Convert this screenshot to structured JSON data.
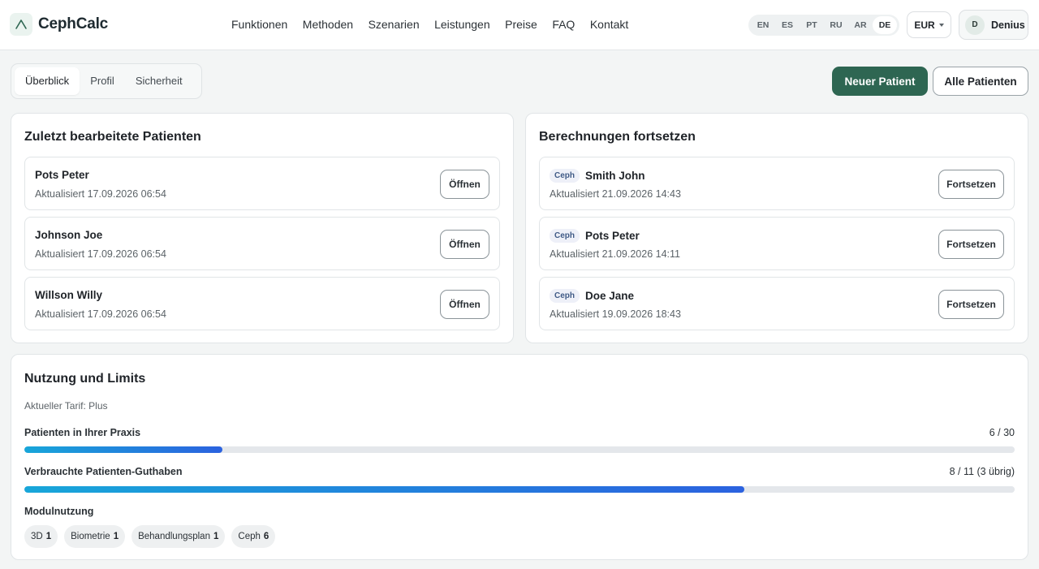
{
  "app": {
    "name": "CephCalc"
  },
  "nav": [
    "Funktionen",
    "Methoden",
    "Szenarien",
    "Leistungen",
    "Preise",
    "FAQ",
    "Kontakt"
  ],
  "languages": {
    "items": [
      "EN",
      "ES",
      "PT",
      "RU",
      "AR",
      "DE"
    ],
    "active": "DE"
  },
  "currency": {
    "value": "EUR"
  },
  "user": {
    "initial": "D",
    "name": "Denius"
  },
  "tabs": {
    "items": [
      "Überblick",
      "Profil",
      "Sicherheit"
    ],
    "active": "Überblick"
  },
  "actions": {
    "new_patient": "Neuer Patient",
    "all_patients": "Alle Patienten"
  },
  "recent_patients": {
    "title": "Zuletzt bearbeitete Patienten",
    "open_label": "Öffnen",
    "items": [
      {
        "name": "Pots Peter",
        "updated": "Aktualisiert 17.09.2026 06:54"
      },
      {
        "name": "Johnson Joe",
        "updated": "Aktualisiert 17.09.2026 06:54"
      },
      {
        "name": "Willson Willy",
        "updated": "Aktualisiert 17.09.2026 06:54"
      }
    ]
  },
  "continue_calc": {
    "title": "Berechnungen fortsetzen",
    "continue_label": "Fortsetzen",
    "items": [
      {
        "tag": "Ceph",
        "name": "Smith John",
        "updated": "Aktualisiert 21.09.2026 14:43"
      },
      {
        "tag": "Ceph",
        "name": "Pots Peter",
        "updated": "Aktualisiert 21.09.2026 14:11"
      },
      {
        "tag": "Ceph",
        "name": "Doe Jane",
        "updated": "Aktualisiert 19.09.2026 18:43"
      }
    ]
  },
  "usage": {
    "title": "Nutzung und Limits",
    "plan": "Aktueller Tarif: Plus",
    "meters": [
      {
        "label": "Patienten in Ihrer Praxis",
        "value_text": "6 / 30",
        "fraction": 0.2
      },
      {
        "label": "Verbrauchte Patienten-Guthaben",
        "value_text": "8 / 11 (3 übrig)",
        "fraction": 0.7273
      }
    ],
    "modules_title": "Modulnutzung",
    "modules": [
      {
        "name": "3D",
        "count": "1"
      },
      {
        "name": "Biometrie",
        "count": "1"
      },
      {
        "name": "Behandlungsplan",
        "count": "1"
      },
      {
        "name": "Ceph",
        "count": "6"
      }
    ]
  },
  "colors": {
    "primary": "#2e6652",
    "meter_start": "#18a6d9",
    "meter_end": "#2b62df",
    "tag_text": "#3f5a86"
  }
}
